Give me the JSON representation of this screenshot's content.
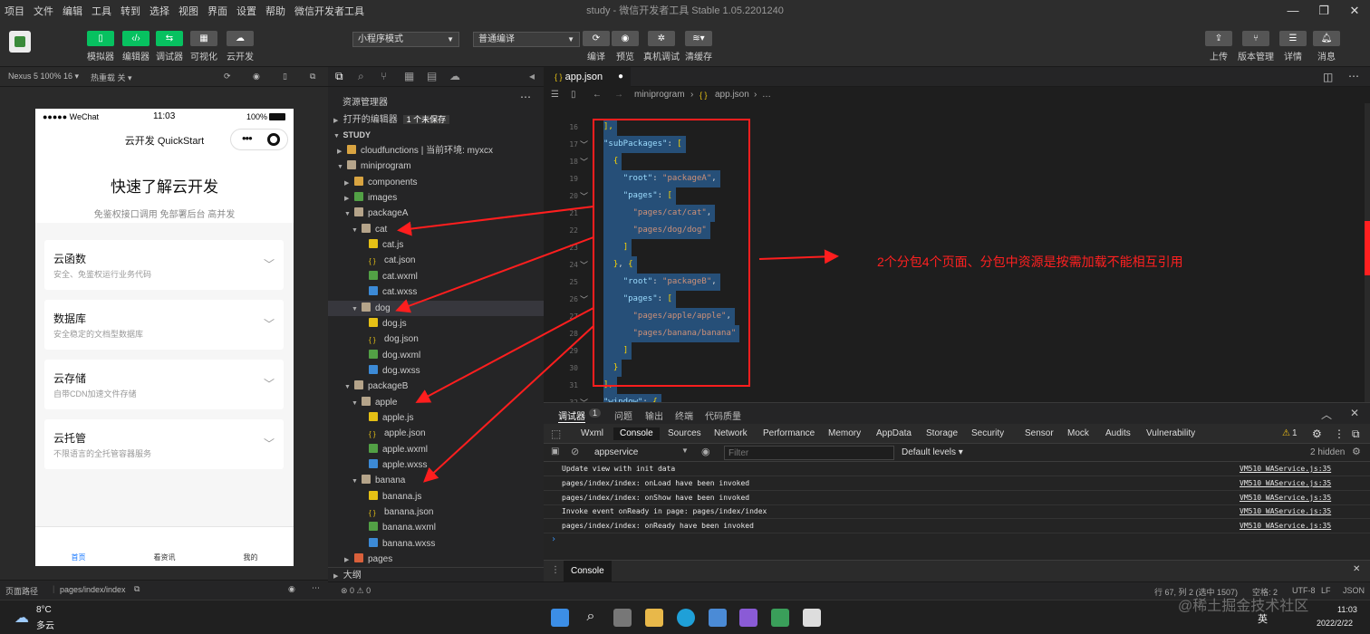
{
  "menu": [
    "项目",
    "文件",
    "编辑",
    "工具",
    "转到",
    "选择",
    "视图",
    "界面",
    "设置",
    "帮助",
    "微信开发者工具"
  ],
  "window_title": "study - 微信开发者工具 Stable 1.05.2201240",
  "toolbar": {
    "left_buttons": [
      "模拟器",
      "编辑器",
      "调试器",
      "可视化",
      "云开发"
    ],
    "mode_select": "小程序模式",
    "compile_select": "普通编译",
    "mid_buttons": [
      "编译",
      "预览",
      "真机调试",
      "清缓存"
    ],
    "right_buttons": [
      "上传",
      "版本管理",
      "详情",
      "消息"
    ]
  },
  "simulator": {
    "device": "Nexus 5 100% 16",
    "hot_reload": "热重载 关",
    "status_carrier": "●●●●● WeChat",
    "status_time": "11:03",
    "status_battery": "100%",
    "nav_title": "云开发 QuickStart",
    "hero_title": "快速了解云开发",
    "hero_subtitle": "免鉴权接口调用 免部署后台 高并发",
    "cards": [
      {
        "title": "云函数",
        "desc": "安全、免鉴权运行业务代码"
      },
      {
        "title": "数据库",
        "desc": "安全稳定的文档型数据库"
      },
      {
        "title": "云存储",
        "desc": "自带CDN加速文件存储"
      },
      {
        "title": "云托管",
        "desc": "不限语言的全托管容器服务"
      }
    ],
    "tabs": [
      "首页",
      "看资讯",
      "我的"
    ],
    "footer_label": "页面路径",
    "footer_path": "pages/index/index"
  },
  "explorer": {
    "title": "资源管理器",
    "open_editors": "打开的编辑器",
    "unsaved_badge": "1 个未保存",
    "project": "STUDY",
    "outline": "大纲",
    "errors": "⊗ 0 ⚠ 0",
    "tree": [
      {
        "label": "cloudfunctions | 当前环境: myxcx",
        "depth": 1,
        "type": "folder",
        "open": false
      },
      {
        "label": "miniprogram",
        "depth": 1,
        "type": "folder-plain",
        "open": true
      },
      {
        "label": "components",
        "depth": 2,
        "type": "folder",
        "open": false
      },
      {
        "label": "images",
        "depth": 2,
        "type": "folder-img",
        "open": false
      },
      {
        "label": "packageA",
        "depth": 2,
        "type": "folder-plain",
        "open": true
      },
      {
        "label": "cat",
        "depth": 3,
        "type": "folder-plain",
        "open": true
      },
      {
        "label": "cat.js",
        "depth": 4,
        "type": "js"
      },
      {
        "label": "cat.json",
        "depth": 4,
        "type": "json"
      },
      {
        "label": "cat.wxml",
        "depth": 4,
        "type": "wxml"
      },
      {
        "label": "cat.wxss",
        "depth": 4,
        "type": "wxss"
      },
      {
        "label": "dog",
        "depth": 3,
        "type": "folder-plain",
        "open": true
      },
      {
        "label": "dog.js",
        "depth": 4,
        "type": "js"
      },
      {
        "label": "dog.json",
        "depth": 4,
        "type": "json"
      },
      {
        "label": "dog.wxml",
        "depth": 4,
        "type": "wxml"
      },
      {
        "label": "dog.wxss",
        "depth": 4,
        "type": "wxss"
      },
      {
        "label": "packageB",
        "depth": 2,
        "type": "folder-plain",
        "open": true
      },
      {
        "label": "apple",
        "depth": 3,
        "type": "folder-plain",
        "open": true
      },
      {
        "label": "apple.js",
        "depth": 4,
        "type": "js"
      },
      {
        "label": "apple.json",
        "depth": 4,
        "type": "json"
      },
      {
        "label": "apple.wxml",
        "depth": 4,
        "type": "wxml"
      },
      {
        "label": "apple.wxss",
        "depth": 4,
        "type": "wxss"
      },
      {
        "label": "banana",
        "depth": 3,
        "type": "folder-plain",
        "open": true
      },
      {
        "label": "banana.js",
        "depth": 4,
        "type": "js"
      },
      {
        "label": "banana.json",
        "depth": 4,
        "type": "json"
      },
      {
        "label": "banana.wxml",
        "depth": 4,
        "type": "wxml"
      },
      {
        "label": "banana.wxss",
        "depth": 4,
        "type": "wxss"
      },
      {
        "label": "pages",
        "depth": 2,
        "type": "folder-red",
        "open": false
      }
    ]
  },
  "editor": {
    "tab": "app.json",
    "breadcrumb_folder": "miniprogram",
    "breadcrumb_file": "app.json",
    "breadcrumb_more": "…",
    "line_numbers": [
      "16",
      "17",
      "18",
      "19",
      "20",
      "21",
      "22",
      "23",
      "24",
      "25",
      "26",
      "27",
      "28",
      "29",
      "30",
      "31",
      "32"
    ],
    "lines": [
      [
        {
          "t": "p",
          "v": "],"
        }
      ],
      [
        {
          "t": "k",
          "v": "\"subPackages\""
        },
        {
          "t": "n",
          "v": ": "
        },
        {
          "t": "p",
          "v": "["
        }
      ],
      [
        {
          "t": "n",
          "v": "  "
        },
        {
          "t": "p",
          "v": "{"
        }
      ],
      [
        {
          "t": "n",
          "v": "    "
        },
        {
          "t": "k",
          "v": "\"root\""
        },
        {
          "t": "n",
          "v": ": "
        },
        {
          "t": "s",
          "v": "\"packageA\""
        },
        {
          "t": "n",
          "v": ","
        }
      ],
      [
        {
          "t": "n",
          "v": "    "
        },
        {
          "t": "k",
          "v": "\"pages\""
        },
        {
          "t": "n",
          "v": ": "
        },
        {
          "t": "p",
          "v": "["
        }
      ],
      [
        {
          "t": "n",
          "v": "      "
        },
        {
          "t": "s",
          "v": "\"pages/cat/cat\""
        },
        {
          "t": "n",
          "v": ","
        }
      ],
      [
        {
          "t": "n",
          "v": "      "
        },
        {
          "t": "s",
          "v": "\"pages/dog/dog\""
        }
      ],
      [
        {
          "t": "n",
          "v": "    "
        },
        {
          "t": "p",
          "v": "]"
        }
      ],
      [
        {
          "t": "n",
          "v": "  "
        },
        {
          "t": "p",
          "v": "}"
        },
        {
          "t": "n",
          "v": ", "
        },
        {
          "t": "p",
          "v": "{"
        }
      ],
      [
        {
          "t": "n",
          "v": "    "
        },
        {
          "t": "k",
          "v": "\"root\""
        },
        {
          "t": "n",
          "v": ": "
        },
        {
          "t": "s",
          "v": "\"packageB\""
        },
        {
          "t": "n",
          "v": ","
        }
      ],
      [
        {
          "t": "n",
          "v": "    "
        },
        {
          "t": "k",
          "v": "\"pages\""
        },
        {
          "t": "n",
          "v": ": "
        },
        {
          "t": "p",
          "v": "["
        }
      ],
      [
        {
          "t": "n",
          "v": "      "
        },
        {
          "t": "s",
          "v": "\"pages/apple/apple\""
        },
        {
          "t": "n",
          "v": ","
        }
      ],
      [
        {
          "t": "n",
          "v": "      "
        },
        {
          "t": "s",
          "v": "\"pages/banana/banana\""
        }
      ],
      [
        {
          "t": "n",
          "v": "    "
        },
        {
          "t": "p",
          "v": "]"
        }
      ],
      [
        {
          "t": "n",
          "v": "  "
        },
        {
          "t": "p",
          "v": "}"
        }
      ],
      [
        {
          "t": "p",
          "v": "],"
        }
      ],
      [
        {
          "t": "k",
          "v": "\"window\""
        },
        {
          "t": "n",
          "v": ": "
        },
        {
          "t": "p",
          "v": "{"
        }
      ]
    ],
    "annotation": "2个分包4个页面、分包中资源是按需加载不能相互引用"
  },
  "devtools": {
    "tabs": [
      "调试器",
      "问题",
      "输出",
      "终端",
      "代码质量"
    ],
    "debugger_badge": "1",
    "panels": [
      "Wxml",
      "Console",
      "Sources",
      "Network",
      "Performance",
      "Memory",
      "AppData",
      "Storage",
      "Security",
      "Sensor",
      "Mock",
      "Audits",
      "Vulnerability"
    ],
    "warn_count": "1",
    "context": "appservice",
    "filter_placeholder": "Filter",
    "levels": "Default levels",
    "hidden": "2 hidden",
    "logs": [
      {
        "msg": "Update view with init data",
        "src": "VM510 WAService.js:35"
      },
      {
        "msg": "pages/index/index: onLoad have been invoked",
        "src": "VM510 WAService.js:35"
      },
      {
        "msg": "pages/index/index: onShow have been invoked",
        "src": "VM510 WAService.js:35"
      },
      {
        "msg": "Invoke event onReady in page: pages/index/index",
        "src": "VM510 WAService.js:35"
      },
      {
        "msg": "pages/index/index: onReady have been invoked",
        "src": "VM510 WAService.js:35"
      }
    ],
    "drawer_tab": "Console"
  },
  "statusbar": {
    "position": "行 67, 列 2 (选中 1507)",
    "spaces": "空格: 2",
    "encoding": "UTF-8",
    "eol": "LF",
    "lang": "JSON"
  },
  "taskbar": {
    "temp": "8°C",
    "weather": "多云",
    "ime": "英",
    "time": "11:03",
    "date": "2022/2/22"
  },
  "watermark": "@稀土掘金技术社区"
}
